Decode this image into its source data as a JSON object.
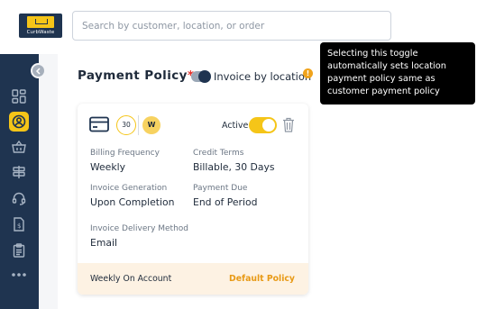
{
  "logo": {
    "text": "CurbWaste",
    "brand_color": "#f5c518"
  },
  "search": {
    "placeholder": "Search by customer, location, or order"
  },
  "sidebar": {
    "items": [
      {
        "icon": "dashboard-icon",
        "active": false
      },
      {
        "icon": "customer-icon",
        "active": true
      },
      {
        "icon": "basket-icon",
        "active": false
      },
      {
        "icon": "signpost-icon",
        "active": false
      },
      {
        "icon": "headset-icon",
        "active": false
      },
      {
        "icon": "invoice-icon",
        "active": false
      },
      {
        "icon": "clipboard-icon",
        "active": false
      },
      {
        "icon": "more-icon",
        "active": false
      }
    ],
    "collapse_icon": "chevron-left-icon"
  },
  "payment_policy": {
    "title": "Payment Policy",
    "required_mark": "*",
    "invoice_by_location_label": "Invoice by location",
    "invoice_by_location_on": true,
    "info_icon": "info-icon"
  },
  "tooltip": {
    "text": "Selecting this toggle automatically sets location payment policy same as customer payment policy"
  },
  "card": {
    "card_icon": "credit-card-icon",
    "cycle_badge": "30",
    "frequency_badge": "W",
    "active_label": "Active",
    "active_on": true,
    "delete_icon": "trash-icon",
    "fields": {
      "billing_frequency": {
        "label": "Billing Frequency",
        "value": "Weekly"
      },
      "credit_terms": {
        "label": "Credit Terms",
        "value": "Billable, 30 Days"
      },
      "invoice_generation": {
        "label": "Invoice Generation",
        "value": "Upon Completion"
      },
      "payment_due": {
        "label": "Payment Due",
        "value": "End of Period"
      },
      "invoice_delivery": {
        "label": "Invoice Delivery Method",
        "value": "Email"
      }
    },
    "footer": {
      "left": "Weekly On Account",
      "right": "Default Policy"
    }
  },
  "colors": {
    "navy": "#1f3450",
    "accent_yellow": "#f5c518",
    "orange": "#e89a16",
    "footer_bg": "#fdf2e3",
    "required_red": "#e5322d"
  }
}
